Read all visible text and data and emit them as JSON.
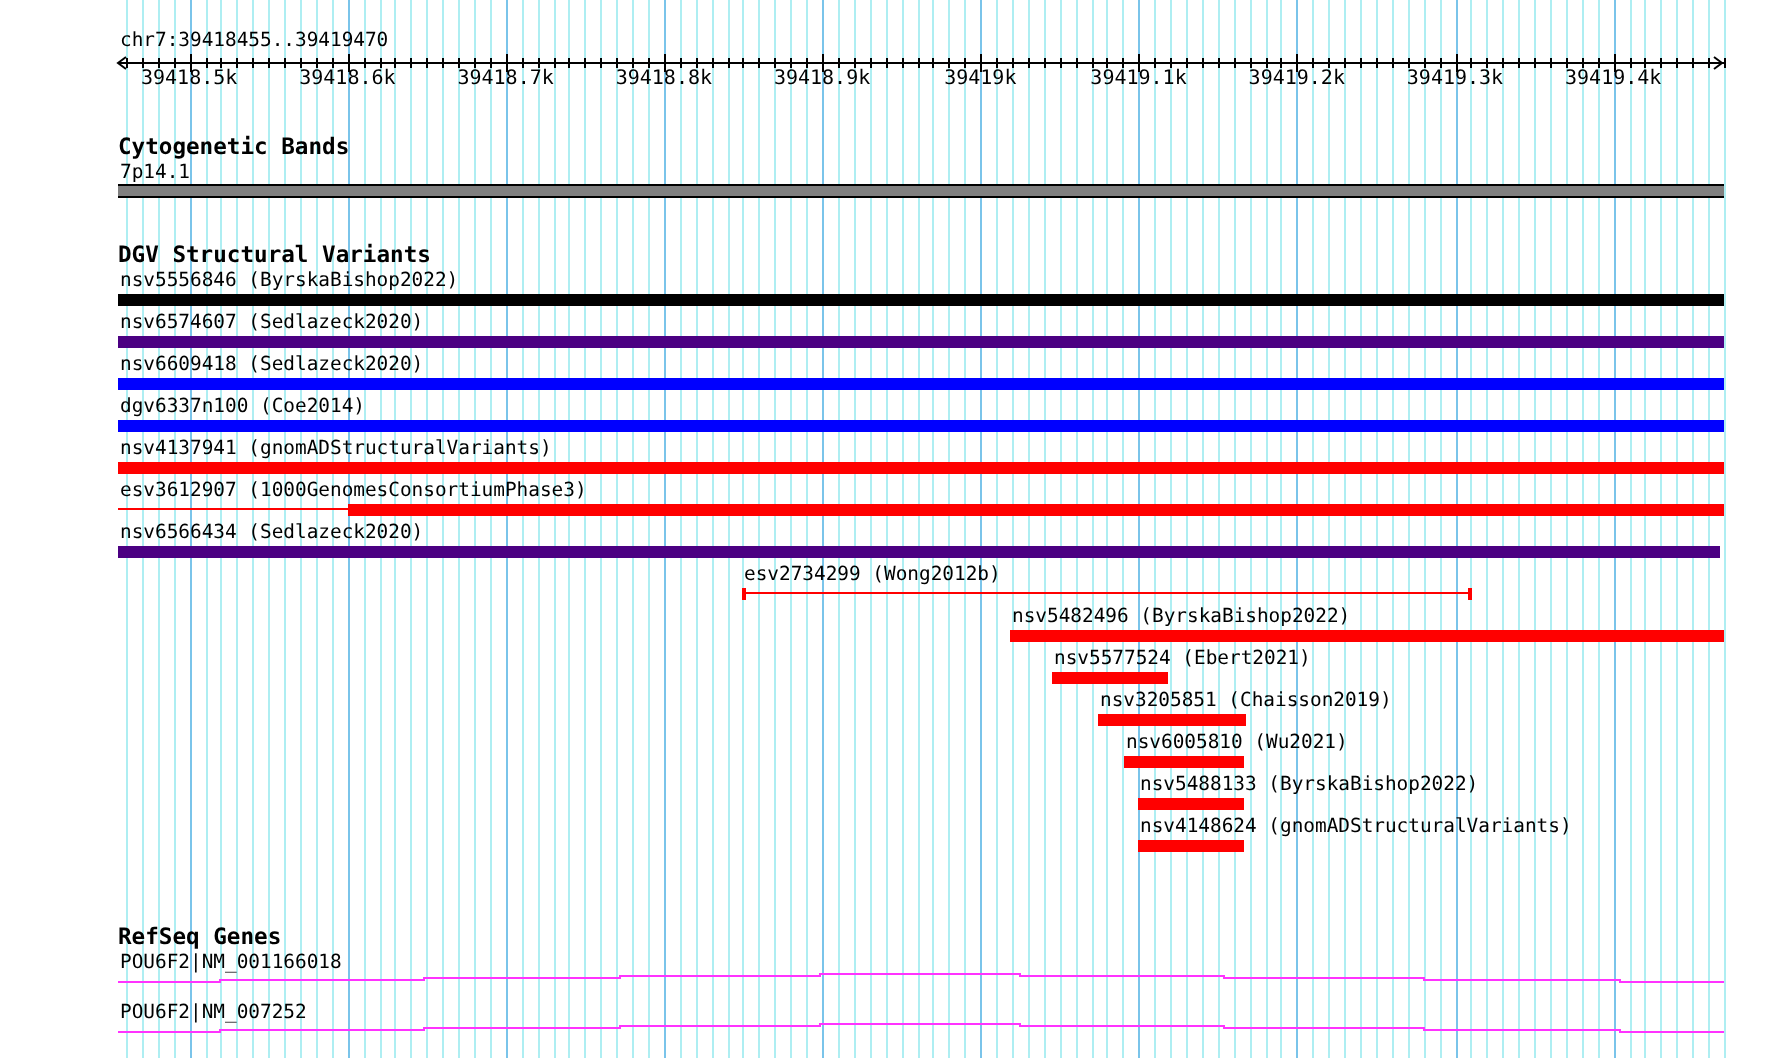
{
  "location": "chr7:39418455..39419470",
  "ruler": {
    "ticks": [
      "39418.5k",
      "39418.6k",
      "39418.7k",
      "39418.8k",
      "39418.9k",
      "39419k",
      "39419.1k",
      "39419.2k",
      "39419.3k",
      "39419.4k"
    ]
  },
  "tracks": [
    {
      "title": "Cytogenetic Bands",
      "features": [
        {
          "label": "7p14.1",
          "kind": "band"
        }
      ]
    },
    {
      "title": "DGV Structural Variants",
      "features": [
        {
          "label": "nsv5556846 (ByrskaBishop2022)",
          "kind": "bar",
          "color": "#000000"
        },
        {
          "label": "nsv6574607 (Sedlazeck2020)",
          "kind": "bar",
          "color": "#4b0082"
        },
        {
          "label": "nsv6609418 (Sedlazeck2020)",
          "kind": "bar",
          "color": "#0000ff"
        },
        {
          "label": "dgv6337n100 (Coe2014)",
          "kind": "bar",
          "color": "#0000ff"
        },
        {
          "label": "nsv4137941 (gnomADStructuralVariants)",
          "kind": "bar",
          "color": "#ff0000"
        },
        {
          "label": "esv3612907 (1000GenomesConsortiumPhase3)",
          "kind": "partial",
          "color": "#ff0000"
        },
        {
          "label": "nsv6566434 (Sedlazeck2020)",
          "kind": "bar",
          "color": "#4b0082"
        },
        {
          "label": "esv2734299 (Wong2012b)",
          "kind": "interval",
          "color": "#ff0000"
        },
        {
          "label": "nsv5482496 (ByrskaBishop2022)",
          "kind": "bar",
          "color": "#ff0000"
        },
        {
          "label": "nsv5577524 (Ebert2021)",
          "kind": "bar",
          "color": "#ff0000"
        },
        {
          "label": "nsv3205851 (Chaisson2019)",
          "kind": "bar",
          "color": "#ff0000"
        },
        {
          "label": "nsv6005810 (Wu2021)",
          "kind": "bar",
          "color": "#ff0000"
        },
        {
          "label": "nsv5488133 (ByrskaBishop2022)",
          "kind": "bar",
          "color": "#ff0000"
        },
        {
          "label": "nsv4148624 (gnomADStructuralVariants)",
          "kind": "bar",
          "color": "#ff0000"
        }
      ]
    },
    {
      "title": "RefSeq Genes",
      "features": [
        {
          "label": "POU6F2|NM_001166018",
          "kind": "transcript"
        },
        {
          "label": "POU6F2|NM_007252",
          "kind": "transcript"
        }
      ]
    }
  ]
}
